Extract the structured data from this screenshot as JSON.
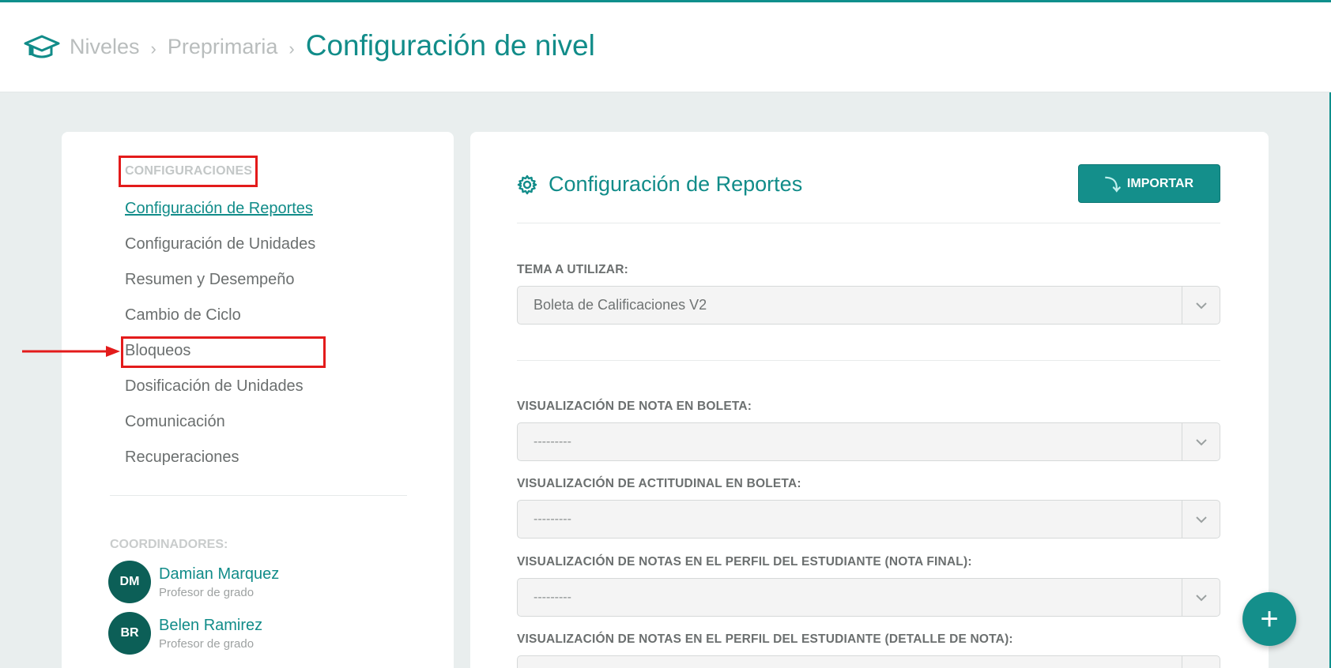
{
  "breadcrumb": {
    "items": [
      "Niveles",
      "Preprimaria"
    ],
    "separator": "›",
    "current": "Configuración de nivel"
  },
  "sidebar": {
    "heading": "CONFIGURACIONES",
    "items": [
      {
        "label": "Configuración de Reportes",
        "active": true
      },
      {
        "label": "Configuración de Unidades"
      },
      {
        "label": "Resumen y Desempeño"
      },
      {
        "label": "Cambio de Ciclo"
      },
      {
        "label": "Bloqueos"
      },
      {
        "label": "Dosificación de Unidades"
      },
      {
        "label": "Comunicación"
      },
      {
        "label": "Recuperaciones"
      }
    ],
    "coordinators_heading": "COORDINADORES:",
    "coordinators": [
      {
        "initials": "DM",
        "name": "Damian Marquez",
        "role": "Profesor de grado"
      },
      {
        "initials": "BR",
        "name": "Belen Ramirez",
        "role": "Profesor de grado"
      }
    ]
  },
  "main": {
    "title": "Configuración de Reportes",
    "title_icon": "gear-icon",
    "import_button": {
      "label": "IMPORTAR",
      "icon": "import-icon"
    },
    "fields": [
      {
        "label": "TEMA A UTILIZAR:",
        "value": "Boleta de Calificaciones V2"
      },
      {
        "label": "VISUALIZACIÓN DE NOTA EN BOLETA:",
        "value": "---------"
      },
      {
        "label": "VISUALIZACIÓN DE ACTITUDINAL EN BOLETA:",
        "value": "---------"
      },
      {
        "label": "VISUALIZACIÓN DE NOTAS EN EL PERFIL DEL ESTUDIANTE (NOTA FINAL):",
        "value": "---------"
      },
      {
        "label": "VISUALIZACIÓN DE NOTAS EN EL PERFIL DEL ESTUDIANTE (DETALLE DE NOTA):",
        "value": ""
      }
    ]
  },
  "fab": {
    "label": "+"
  },
  "colors": {
    "accent": "#148f8b",
    "annotation": "#e31b1b",
    "avatar": "#0c5f57"
  }
}
